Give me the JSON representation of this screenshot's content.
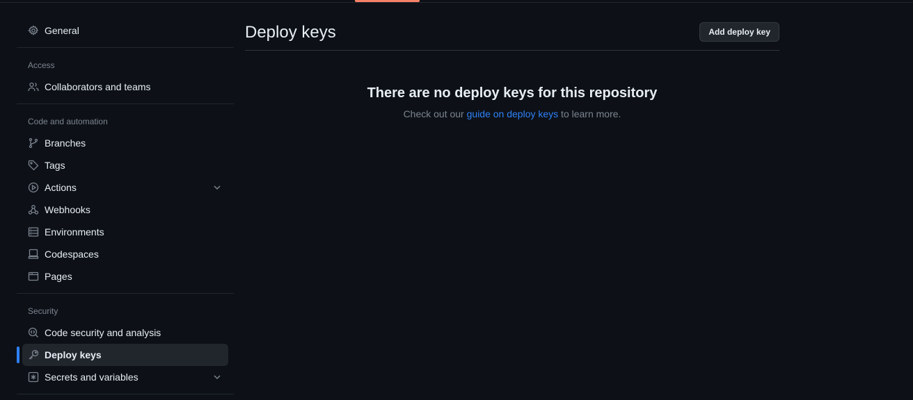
{
  "sidebar": {
    "general": "General",
    "sections": [
      {
        "label": "Access",
        "items": [
          {
            "label": "Collaborators and teams",
            "icon": "people-icon"
          }
        ]
      },
      {
        "label": "Code and automation",
        "items": [
          {
            "label": "Branches",
            "icon": "git-branch-icon"
          },
          {
            "label": "Tags",
            "icon": "tag-icon"
          },
          {
            "label": "Actions",
            "icon": "play-icon",
            "expandable": true
          },
          {
            "label": "Webhooks",
            "icon": "webhook-icon"
          },
          {
            "label": "Environments",
            "icon": "server-icon"
          },
          {
            "label": "Codespaces",
            "icon": "codespaces-icon"
          },
          {
            "label": "Pages",
            "icon": "browser-icon"
          }
        ]
      },
      {
        "label": "Security",
        "items": [
          {
            "label": "Code security and analysis",
            "icon": "codescan-icon"
          },
          {
            "label": "Deploy keys",
            "icon": "key-icon",
            "active": true
          },
          {
            "label": "Secrets and variables",
            "icon": "asterisk-icon",
            "expandable": true
          }
        ]
      }
    ]
  },
  "main": {
    "title": "Deploy keys",
    "add_button": "Add deploy key",
    "blank_title": "There are no deploy keys for this repository",
    "blank_text_before": "Check out our ",
    "blank_link": "guide on deploy keys",
    "blank_text_after": " to learn more."
  },
  "colors": {
    "background": "#0d1117",
    "accent": "#2f81f7",
    "tab_underline": "#f78166"
  }
}
